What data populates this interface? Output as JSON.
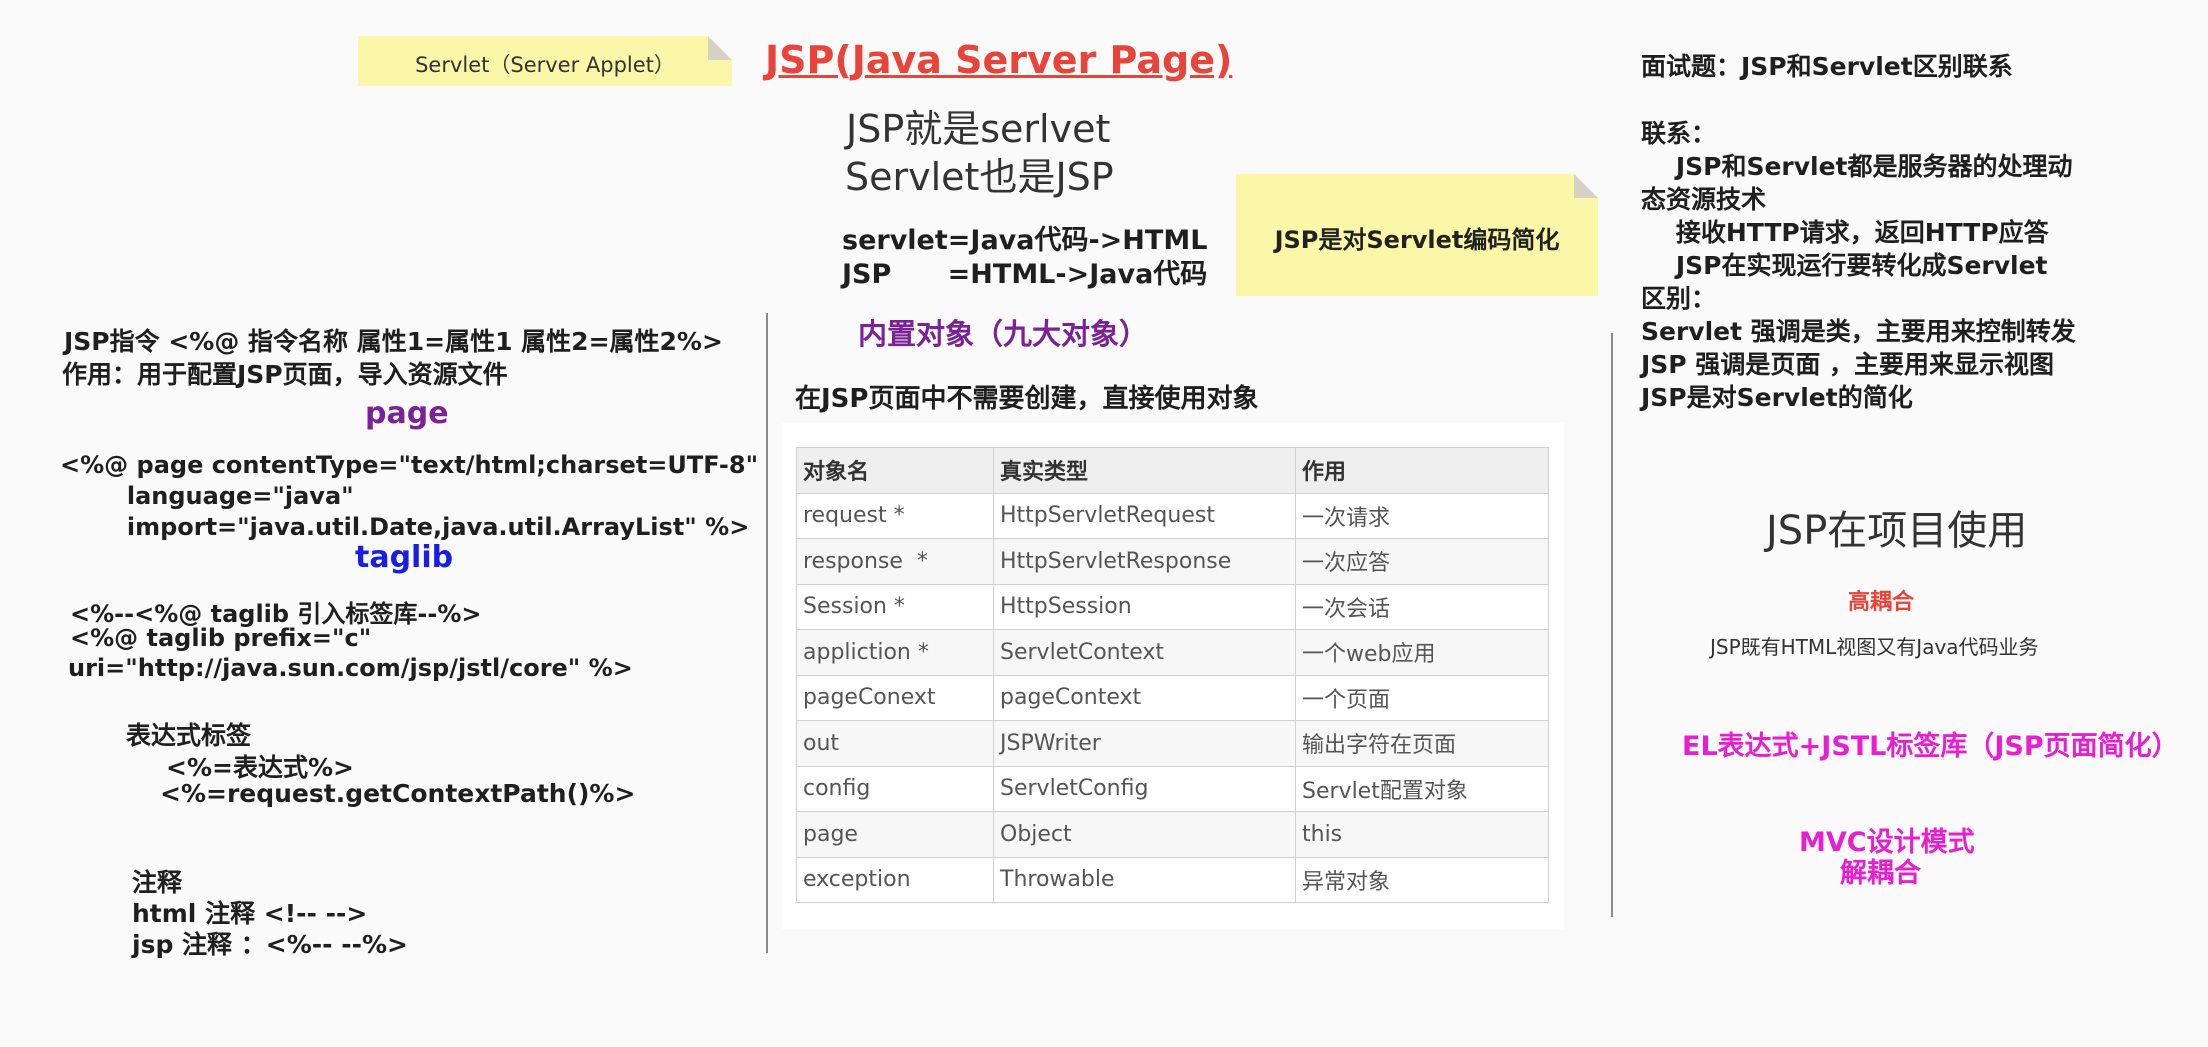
{
  "colors": {
    "title_red": "#e8443a",
    "purple": "#7a2296",
    "blue": "#1a1ee0",
    "magenta": "#e81fd0",
    "red": "#e8443a",
    "sticky": "#fbf7a8"
  },
  "notes": {
    "servlet_applet": "Servlet（Server Applet）",
    "simplify": "JSP是对Servlet编码简化"
  },
  "title": "JSP(Java Server Page)",
  "intro": {
    "line1": "JSP就是serlvet",
    "line2": "Servlet也是JSP",
    "conv1": "servlet=Java代码->HTML",
    "conv2": "JSP      =HTML->Java代码"
  },
  "left": {
    "directive_syntax": "JSP指令 <%@ 指令名称 属性1=属性1 属性2=属性2%>",
    "directive_use": "作用：用于配置JSP页面，导入资源文件",
    "page_heading": "page",
    "page_code": [
      "<%@ page contentType=\"text/html;charset=UTF-8\"",
      "        language=\"java\"",
      "        import=\"java.util.Date,java.util.ArrayList\" %>"
    ],
    "taglib_heading": "taglib",
    "taglib_code": [
      "<%--<%@ taglib 引入标签库--%>",
      "<%@ taglib prefix=\"c\"",
      "uri=\"http://java.sun.com/jsp/jstl/core\" %>"
    ],
    "expr_title": "表达式标签",
    "expr_lines": [
      "<%=表达式%>",
      "<%=request.getContextPath()%>"
    ],
    "comment_title": "注释",
    "comment_lines": [
      "html 注释 <!-- -->",
      "jsp 注释 ：<%-- --%>"
    ]
  },
  "center": {
    "builtin_title": "内置对象（九大对象）",
    "builtin_desc": "在JSP页面中不需要创建，直接使用对象",
    "table": {
      "headers": [
        "对象名",
        "真实类型",
        "作用"
      ],
      "rows": [
        [
          "request *",
          "HttpServletRequest",
          "一次请求"
        ],
        [
          "response  *",
          "HttpServletResponse",
          "一次应答"
        ],
        [
          "Session *",
          "HttpSession",
          "一次会话"
        ],
        [
          "appliction *",
          "ServletContext",
          "一个web应用"
        ],
        [
          "pageConext",
          "pageContext",
          "一个页面"
        ],
        [
          "out",
          "JSPWriter",
          "输出字符在页面"
        ],
        [
          "config",
          "ServletConfig",
          "Servlet配置对象"
        ],
        [
          "page",
          "Object",
          "this"
        ],
        [
          "exception",
          "Throwable",
          "异常对象"
        ]
      ]
    }
  },
  "right": {
    "interview": "面试题：JSP和Servlet区别联系",
    "relation_title": "联系：",
    "relation_lines": [
      "    JSP和Servlet都是服务器的处理动",
      "态资源技术",
      "    接收HTTP请求，返回HTTP应答",
      "    JSP在实现运行要转化成Servlet"
    ],
    "diff_title": "区别：",
    "diff_lines": [
      "Servlet 强调是类，主要用来控制转发",
      "JSP 强调是页面 ，主要用来显示视图",
      "JSP是对Servlet的简化"
    ],
    "project_title": "JSP在项目使用",
    "high_coupling": "高耦合",
    "mixed": "JSP既有HTML视图又有Java代码业务",
    "el_jstl": "EL表达式+JSTL标签库（JSP页面简化）",
    "mvc": "MVC设计模式",
    "decouple": "解耦合"
  }
}
